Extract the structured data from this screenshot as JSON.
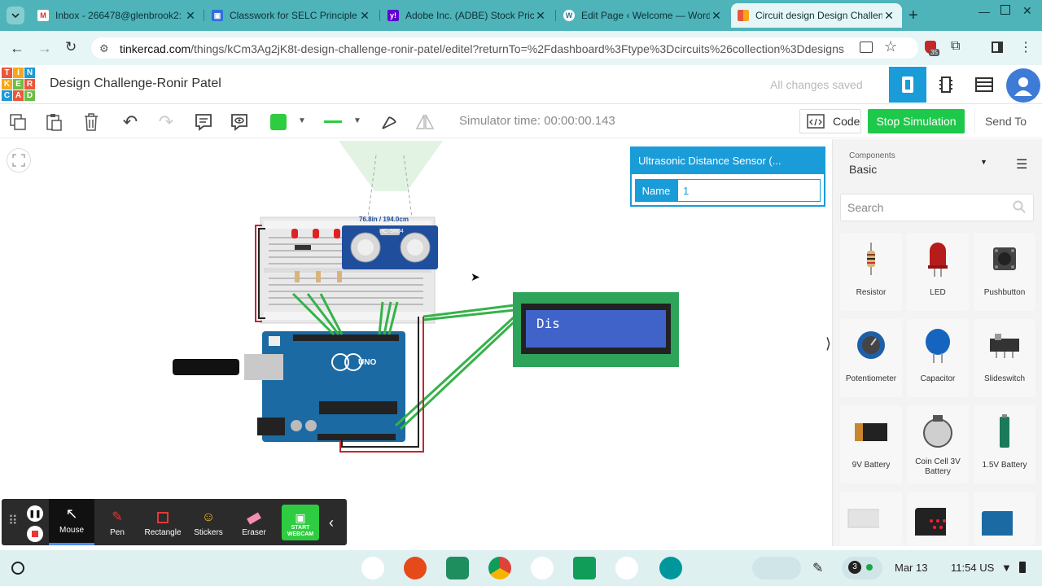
{
  "browser": {
    "tabs": [
      {
        "title": "Inbox - 266478@glenbrook2:",
        "favicon": "gmail-icon",
        "color": "#d93025"
      },
      {
        "title": "Classwork for SELC Principle",
        "favicon": "classroom-icon",
        "color": "#2f6fd8"
      },
      {
        "title": "Adobe Inc. (ADBE) Stock Pric",
        "favicon": "yahoo-icon",
        "color": "#6001d2"
      },
      {
        "title": "Edit Page ‹ Welcome — Word",
        "favicon": "wordpress-icon",
        "color": "#21759b"
      },
      {
        "title": "Circuit design Design Challen",
        "favicon": "tinkercad-icon",
        "color": "#e8573b"
      }
    ],
    "url_domain": "tinkercad.com",
    "url_path": "/things/kCm3Ag2jK8t-design-challenge-ronir-patel/editel?returnTo=%2Fdashboard%3Ftype%3Dcircuits%26collection%3Ddesigns",
    "extension_badge": "35"
  },
  "app": {
    "logo_letters": [
      "TIN",
      "KER",
      "CAD"
    ],
    "title": "Design Challenge-Ronir Patel",
    "save_status": "All changes saved"
  },
  "toolbar": {
    "color_swatch": "#2ecc40",
    "simulator_time": "Simulator time: 00:00:00.143",
    "code_label": "Code",
    "stop_label": "Stop Simulation",
    "send_label": "Send To"
  },
  "properties": {
    "header": "Ultrasonic Distance Sensor (...",
    "name_label": "Name",
    "name_value": "1"
  },
  "circuit": {
    "sensor_label": "HC-SR04",
    "sensor_readout": "76.8in / 194.0cm",
    "lcd_text": "Dis",
    "arduino_label": "UNO"
  },
  "components_panel": {
    "category_label": "Components",
    "category_value": "Basic",
    "search_placeholder": "Search",
    "items": [
      {
        "label": "Resistor"
      },
      {
        "label": "LED"
      },
      {
        "label": "Pushbutton"
      },
      {
        "label": "Potentiometer"
      },
      {
        "label": "Capacitor"
      },
      {
        "label": "Slideswitch"
      },
      {
        "label": "9V Battery"
      },
      {
        "label": "Coin Cell 3V Battery"
      },
      {
        "label": "1.5V Battery"
      },
      {
        "label": ""
      },
      {
        "label": ""
      },
      {
        "label": ""
      }
    ]
  },
  "drawing_tools": {
    "items": [
      {
        "label": "Mouse"
      },
      {
        "label": "Pen"
      },
      {
        "label": "Rectangle"
      },
      {
        "label": "Stickers"
      },
      {
        "label": "Eraser"
      }
    ],
    "webcam_label": "START WEBCAM"
  },
  "shelf": {
    "notif_count": "3",
    "date": "Mar 13",
    "time": "11:54",
    "locale": "US"
  }
}
